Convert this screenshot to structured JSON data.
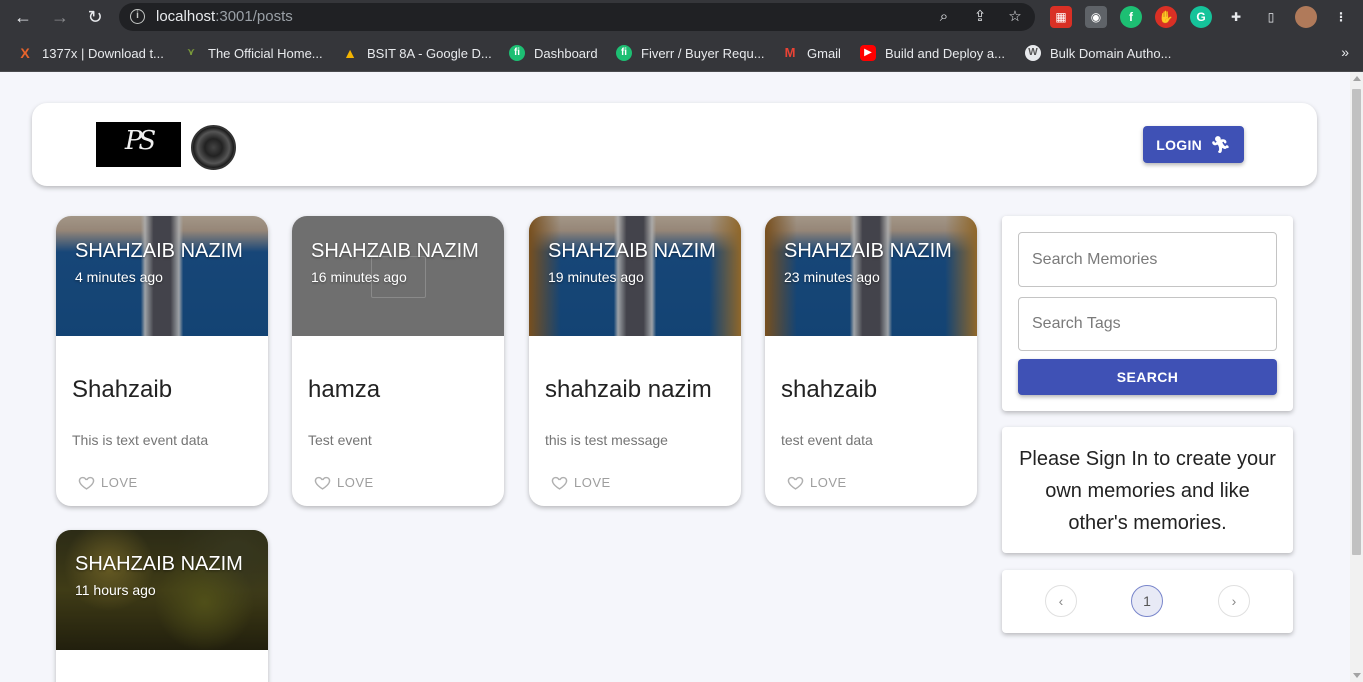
{
  "browser": {
    "url_host": "localhost",
    "url_path": ":3001/posts",
    "bookmarks": [
      {
        "label": "1377x | Download t...",
        "color": "#e8642c",
        "icon": "x-icon"
      },
      {
        "label": "The Official Home...",
        "color": "#7a9a3a",
        "icon": "vue-icon"
      },
      {
        "label": "BSIT 8A - Google D...",
        "color": "#f4b400",
        "icon": "drive-icon"
      },
      {
        "label": "Dashboard",
        "color": "#1dbf73",
        "icon": "fiverr-icon"
      },
      {
        "label": "Fiverr / Buyer Requ...",
        "color": "#1dbf73",
        "icon": "fiverr-icon"
      },
      {
        "label": "Gmail",
        "color": "#ea4335",
        "icon": "gmail-icon"
      },
      {
        "label": "Build and Deploy a...",
        "color": "#ff0000",
        "icon": "youtube-icon"
      },
      {
        "label": "Bulk Domain Autho...",
        "color": "#888888",
        "icon": "wordpress-icon"
      }
    ],
    "more": "»"
  },
  "header": {
    "login_label": "LOGIN"
  },
  "posts": [
    {
      "author": "SHAHZAIB NAZIM",
      "time": "4 minutes ago",
      "title": "Shahzaib",
      "message": "This is text event data",
      "love_label": "LOVE"
    },
    {
      "author": "SHAHZAIB NAZIM",
      "time": "16 minutes ago",
      "title": "hamza",
      "message": "Test event",
      "love_label": "LOVE"
    },
    {
      "author": "SHAHZAIB NAZIM",
      "time": "19 minutes ago",
      "title": "shahzaib nazim",
      "message": "this is test message",
      "love_label": "LOVE"
    },
    {
      "author": "SHAHZAIB NAZIM",
      "time": "23 minutes ago",
      "title": "shahzaib",
      "message": "test event data",
      "love_label": "LOVE"
    },
    {
      "author": "SHAHZAIB NAZIM",
      "time": "11 hours ago"
    }
  ],
  "search": {
    "memories_placeholder": "Search Memories",
    "tags_placeholder": "Search Tags",
    "button_label": "SEARCH"
  },
  "signin_notice": "Please Sign In to create your own memories and like other's memories.",
  "pagination": {
    "prev": "‹",
    "current": "1",
    "next": "›"
  },
  "colors": {
    "primary": "#3f51b5",
    "background": "#f5f6fb"
  }
}
